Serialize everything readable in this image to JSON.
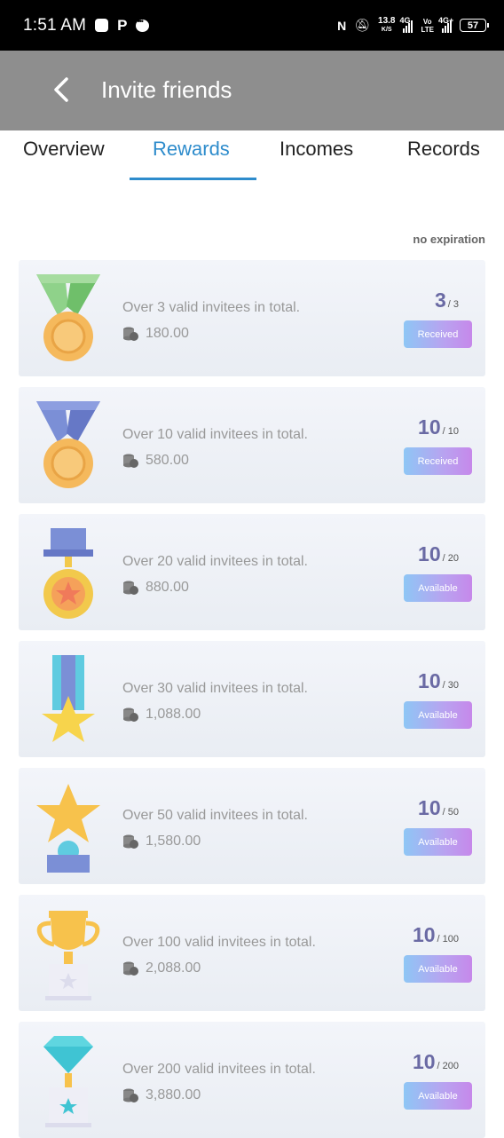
{
  "status_bar": {
    "time": "1:51 AM",
    "speed_value": "13.8",
    "speed_unit": "K/S",
    "net1": "4G",
    "volte_top": "Vo",
    "volte_bottom": "LTE",
    "net2": "4G+",
    "battery": "57"
  },
  "header": {
    "title": "Invite friends"
  },
  "tabs": [
    {
      "label": "Overview"
    },
    {
      "label": "Rewards"
    },
    {
      "label": "Incomes"
    },
    {
      "label": "Records"
    }
  ],
  "active_tab": "Rewards",
  "expiry_note": "no expiration",
  "colors": {
    "accent": "#2e8ccc",
    "header_bg": "#8e8e8e",
    "progress": "#6a6aa4"
  },
  "rewards": [
    {
      "medal": "green-ribbon-medal-icon",
      "description": "Over 3 valid invitees in total.",
      "amount": "180.00",
      "current": "3",
      "total": "/ 3",
      "button": "Received"
    },
    {
      "medal": "blue-ribbon-medal-icon",
      "description": "Over 10 valid invitees in total.",
      "amount": "580.00",
      "current": "10",
      "total": "/ 10",
      "button": "Received"
    },
    {
      "medal": "star-pendant-medal-icon",
      "description": "Over 20 valid invitees in total.",
      "amount": "880.00",
      "current": "10",
      "total": "/ 20",
      "button": "Available"
    },
    {
      "medal": "star-ribbon-medal-icon",
      "description": "Over 30 valid invitees in total.",
      "amount": "1,088.00",
      "current": "10",
      "total": "/ 30",
      "button": "Available"
    },
    {
      "medal": "star-trophy-icon",
      "description": "Over 50 valid invitees in total.",
      "amount": "1,580.00",
      "current": "10",
      "total": "/ 50",
      "button": "Available"
    },
    {
      "medal": "gold-cup-trophy-icon",
      "description": "Over 100 valid invitees in total.",
      "amount": "2,088.00",
      "current": "10",
      "total": "/ 100",
      "button": "Available"
    },
    {
      "medal": "diamond-trophy-icon",
      "description": "Over 200 valid invitees in total.",
      "amount": "3,880.00",
      "current": "10",
      "total": "/ 200",
      "button": "Available"
    }
  ]
}
